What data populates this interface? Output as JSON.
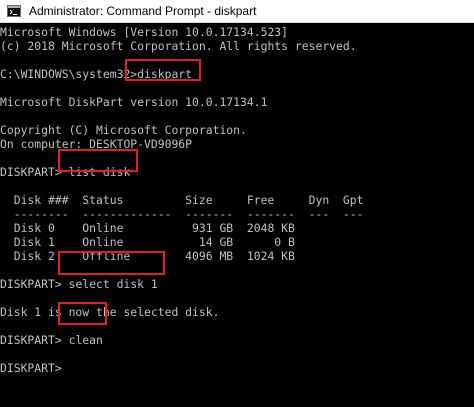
{
  "window": {
    "title": "Administrator: Command Prompt - diskpart",
    "icon": "cmd-icon"
  },
  "console": {
    "header_1": "Microsoft Windows [Version 10.0.17134.523]",
    "header_2": "(c) 2018 Microsoft Corporation. All rights reserved.",
    "prompt_path": "C:\\WINDOWS\\system32>",
    "cmd_diskpart": "diskpart",
    "dp_version": "Microsoft DiskPart version 10.0.17134.1",
    "copyright": "Copyright (C) Microsoft Corporation.",
    "computer": "On computer: DESKTOP-VD9096P",
    "dp_prompt": "DISKPART>",
    "cmd_list": "list disk",
    "table_header": "  Disk ###  Status         Size     Free     Dyn  Gpt",
    "table_rule": "  --------  -------------  -------  -------  ---  ---",
    "rows": [
      "  Disk 0    Online          931 GB  2048 KB",
      "  Disk 1    Online           14 GB      0 B",
      "  Disk 2    Offline        4096 MB  1024 KB"
    ],
    "cmd_select": "select disk 1",
    "select_msg": "Disk 1 is now the selected disk.",
    "cmd_clean": "clean",
    "final_prompt": "DISKPART>"
  },
  "colors": {
    "console_bg": "#000000",
    "console_text": "#c0c0c0",
    "highlight": "#e51c23"
  }
}
